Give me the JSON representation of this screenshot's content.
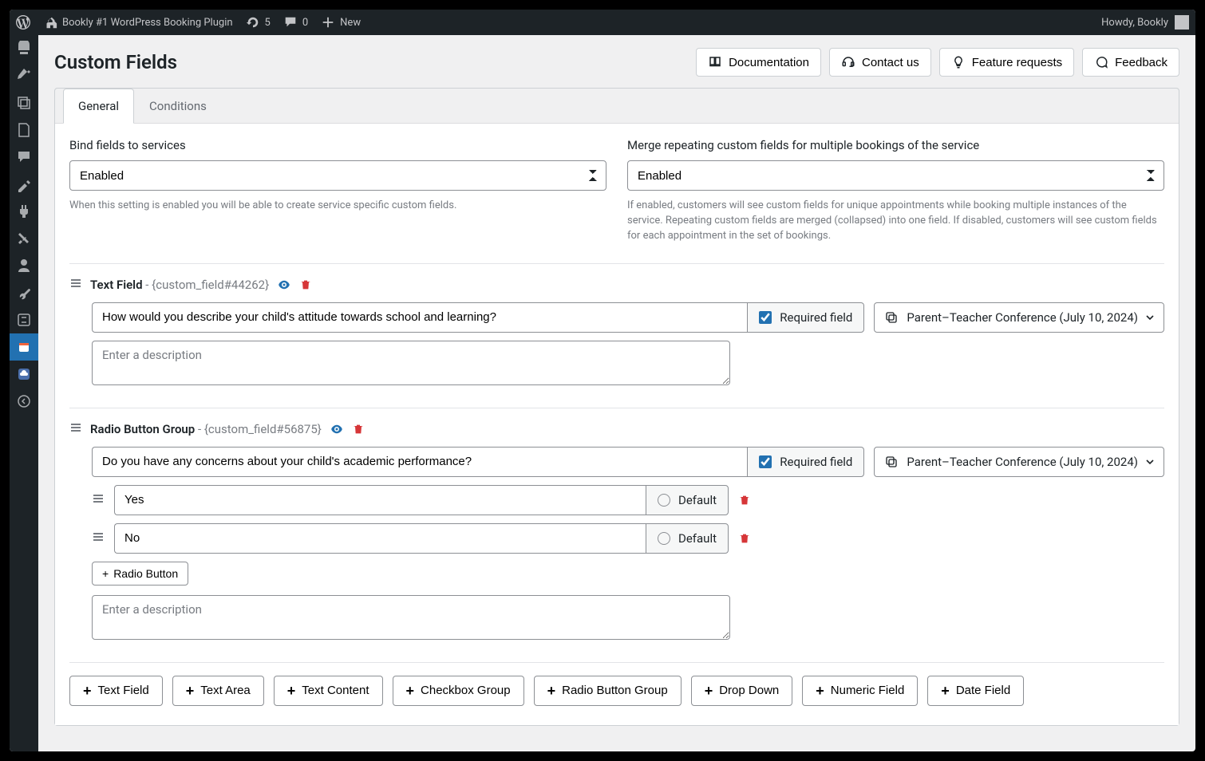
{
  "adminbar": {
    "site_title": "Bookly #1 WordPress Booking Plugin",
    "updates_count": "5",
    "comments_count": "0",
    "new_label": "New",
    "howdy": "Howdy, Bookly"
  },
  "page": {
    "title": "Custom Fields",
    "buttons": {
      "documentation": "Documentation",
      "contact": "Contact us",
      "features": "Feature requests",
      "feedback": "Feedback"
    }
  },
  "tabs": {
    "general": "General",
    "conditions": "Conditions"
  },
  "settings": {
    "bind": {
      "label": "Bind fields to services",
      "value": "Enabled",
      "hint": "When this setting is enabled you will be able to create service specific custom fields."
    },
    "merge": {
      "label": "Merge repeating custom fields for multiple bookings of the service",
      "value": "Enabled",
      "hint": "If enabled, customers will see custom fields for unique appointments while booking multiple instances of the service. Repeating custom fields are merged (collapsed) into one field. If disabled, customers will see custom fields for each appointment in the set of bookings."
    }
  },
  "fields": [
    {
      "type_label": "Text Field",
      "code": "{custom_field#44262}",
      "question": "How would you describe your child's attitude towards school and learning?",
      "required_label": "Required field",
      "required": true,
      "service": "Parent–Teacher Conference (July 10, 2024)",
      "description_placeholder": "Enter a description"
    },
    {
      "type_label": "Radio Button Group",
      "code": "{custom_field#56875}",
      "question": "Do you have any concerns about your child's academic performance?",
      "required_label": "Required field",
      "required": true,
      "service": "Parent–Teacher Conference (July 10, 2024)",
      "options": [
        {
          "label": "Yes",
          "default_label": "Default"
        },
        {
          "label": "No",
          "default_label": "Default"
        }
      ],
      "add_option_label": "Radio Button",
      "description_placeholder": "Enter a description"
    }
  ],
  "field_type_buttons": [
    "Text Field",
    "Text Area",
    "Text Content",
    "Checkbox Group",
    "Radio Button Group",
    "Drop Down",
    "Numeric Field",
    "Date Field"
  ]
}
